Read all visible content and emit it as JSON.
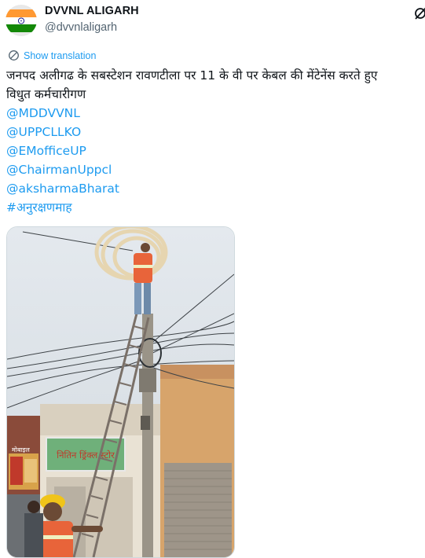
{
  "account": {
    "display_name": "DVVNL ALIGARH",
    "handle": "@dvvnlaligarh",
    "avatar_icon": "india-flag-icon"
  },
  "translate": {
    "label": "Show translation",
    "icon": "globe-translate-icon"
  },
  "tweet": {
    "text_line1": "जनपद अलीगढ के सबस्टेशन रावणटीला पर 11 के वी पर केबल की मेंटेनेंस करते हुए",
    "text_line2": "विधुत कर्मचारीगण",
    "mentions": [
      "@MDDVVNL",
      "@UPPCLLKO",
      "@EMofficeUP",
      "@ChairmanUppcl",
      "@aksharmaBharat"
    ],
    "hashtag": "#अनुरक्षणमाह"
  },
  "media": {
    "shop_sign": "नितिन ड्रिंक्ल स्टोर",
    "poster_text": "मोबाइल"
  },
  "colors": {
    "link": "#1d9bf0",
    "secondary_text": "#536471",
    "saffron": "#ff9933",
    "green": "#138808",
    "ashoka_blue": "#000080"
  }
}
